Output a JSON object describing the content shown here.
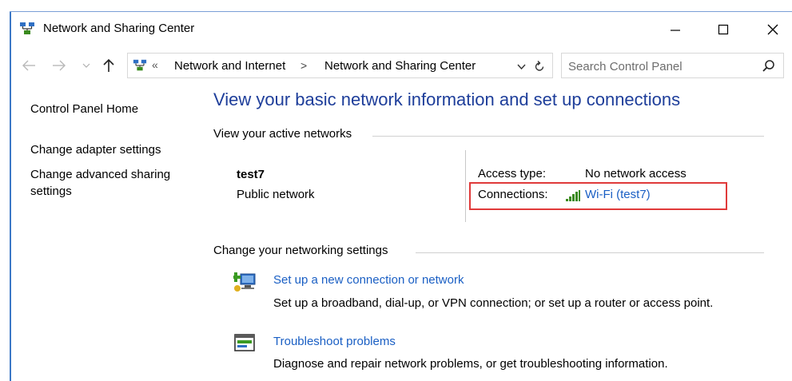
{
  "window": {
    "title": "Network and Sharing Center"
  },
  "address_bar": {
    "chevron": "«",
    "segments": [
      "Network and Internet",
      "Network and Sharing Center"
    ],
    "separator": ">"
  },
  "search": {
    "placeholder": "Search Control Panel"
  },
  "sidebar": {
    "items": [
      {
        "label": "Control Panel Home"
      },
      {
        "label": "Change adapter settings"
      },
      {
        "label": "Change advanced sharing settings"
      }
    ]
  },
  "main": {
    "title": "View your basic network information and set up connections",
    "active_networks_heading": "View your active networks",
    "network": {
      "name": "test7",
      "type": "Public network",
      "access_type_label": "Access type:",
      "access_type_value": "No network access",
      "connections_label": "Connections:",
      "connections_value": "Wi-Fi (test7)"
    },
    "change_settings_heading": "Change your networking settings",
    "tasks": [
      {
        "link": "Set up a new connection or network",
        "description": "Set up a broadband, dial-up, or VPN connection; or set up a router or access point."
      },
      {
        "link": "Troubleshoot problems",
        "description": "Diagnose and repair network problems, or get troubleshooting information."
      }
    ]
  },
  "colors": {
    "title_blue": "#1e3e9a",
    "link_blue": "#1a5fc4",
    "highlight_red": "#e03a3a",
    "wifi_green": "#3a8a1e"
  },
  "icons": {
    "app": "network-center-icon",
    "back": "back-arrow-icon",
    "forward": "forward-arrow-icon",
    "up": "up-arrow-icon",
    "refresh": "refresh-icon",
    "search": "search-icon",
    "wifi": "wifi-signal-icon"
  }
}
